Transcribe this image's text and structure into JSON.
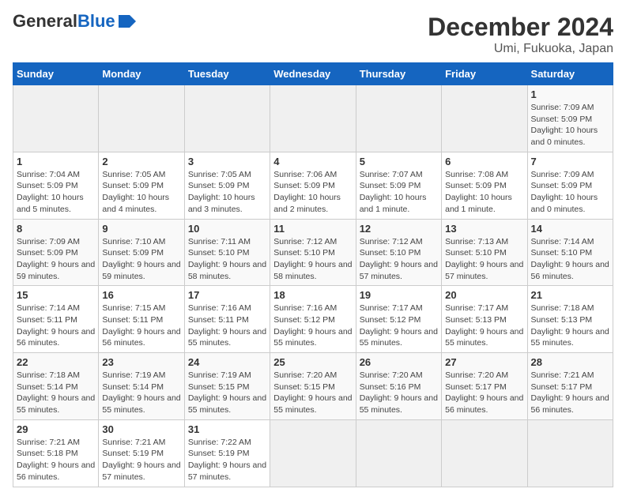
{
  "header": {
    "logo_general": "General",
    "logo_blue": "Blue",
    "title": "December 2024",
    "subtitle": "Umi, Fukuoka, Japan"
  },
  "calendar": {
    "columns": [
      "Sunday",
      "Monday",
      "Tuesday",
      "Wednesday",
      "Thursday",
      "Friday",
      "Saturday"
    ],
    "weeks": [
      [
        {
          "day": "",
          "empty": true
        },
        {
          "day": "",
          "empty": true
        },
        {
          "day": "",
          "empty": true
        },
        {
          "day": "",
          "empty": true
        },
        {
          "day": "",
          "empty": true
        },
        {
          "day": "",
          "empty": true
        },
        {
          "day": "1",
          "sunrise": "7:09 AM",
          "sunset": "5:09 PM",
          "daylight": "10 hours and 0 minutes."
        }
      ],
      [
        {
          "day": "1",
          "sunrise": "7:04 AM",
          "sunset": "5:09 PM",
          "daylight": "10 hours and 5 minutes."
        },
        {
          "day": "2",
          "sunrise": "7:05 AM",
          "sunset": "5:09 PM",
          "daylight": "10 hours and 4 minutes."
        },
        {
          "day": "3",
          "sunrise": "7:05 AM",
          "sunset": "5:09 PM",
          "daylight": "10 hours and 3 minutes."
        },
        {
          "day": "4",
          "sunrise": "7:06 AM",
          "sunset": "5:09 PM",
          "daylight": "10 hours and 2 minutes."
        },
        {
          "day": "5",
          "sunrise": "7:07 AM",
          "sunset": "5:09 PM",
          "daylight": "10 hours and 1 minute."
        },
        {
          "day": "6",
          "sunrise": "7:08 AM",
          "sunset": "5:09 PM",
          "daylight": "10 hours and 1 minute."
        },
        {
          "day": "7",
          "sunrise": "7:09 AM",
          "sunset": "5:09 PM",
          "daylight": "10 hours and 0 minutes."
        }
      ],
      [
        {
          "day": "8",
          "sunrise": "7:09 AM",
          "sunset": "5:09 PM",
          "daylight": "9 hours and 59 minutes."
        },
        {
          "day": "9",
          "sunrise": "7:10 AM",
          "sunset": "5:09 PM",
          "daylight": "9 hours and 59 minutes."
        },
        {
          "day": "10",
          "sunrise": "7:11 AM",
          "sunset": "5:10 PM",
          "daylight": "9 hours and 58 minutes."
        },
        {
          "day": "11",
          "sunrise": "7:12 AM",
          "sunset": "5:10 PM",
          "daylight": "9 hours and 58 minutes."
        },
        {
          "day": "12",
          "sunrise": "7:12 AM",
          "sunset": "5:10 PM",
          "daylight": "9 hours and 57 minutes."
        },
        {
          "day": "13",
          "sunrise": "7:13 AM",
          "sunset": "5:10 PM",
          "daylight": "9 hours and 57 minutes."
        },
        {
          "day": "14",
          "sunrise": "7:14 AM",
          "sunset": "5:10 PM",
          "daylight": "9 hours and 56 minutes."
        }
      ],
      [
        {
          "day": "15",
          "sunrise": "7:14 AM",
          "sunset": "5:11 PM",
          "daylight": "9 hours and 56 minutes."
        },
        {
          "day": "16",
          "sunrise": "7:15 AM",
          "sunset": "5:11 PM",
          "daylight": "9 hours and 56 minutes."
        },
        {
          "day": "17",
          "sunrise": "7:16 AM",
          "sunset": "5:11 PM",
          "daylight": "9 hours and 55 minutes."
        },
        {
          "day": "18",
          "sunrise": "7:16 AM",
          "sunset": "5:12 PM",
          "daylight": "9 hours and 55 minutes."
        },
        {
          "day": "19",
          "sunrise": "7:17 AM",
          "sunset": "5:12 PM",
          "daylight": "9 hours and 55 minutes."
        },
        {
          "day": "20",
          "sunrise": "7:17 AM",
          "sunset": "5:13 PM",
          "daylight": "9 hours and 55 minutes."
        },
        {
          "day": "21",
          "sunrise": "7:18 AM",
          "sunset": "5:13 PM",
          "daylight": "9 hours and 55 minutes."
        }
      ],
      [
        {
          "day": "22",
          "sunrise": "7:18 AM",
          "sunset": "5:14 PM",
          "daylight": "9 hours and 55 minutes."
        },
        {
          "day": "23",
          "sunrise": "7:19 AM",
          "sunset": "5:14 PM",
          "daylight": "9 hours and 55 minutes."
        },
        {
          "day": "24",
          "sunrise": "7:19 AM",
          "sunset": "5:15 PM",
          "daylight": "9 hours and 55 minutes."
        },
        {
          "day": "25",
          "sunrise": "7:20 AM",
          "sunset": "5:15 PM",
          "daylight": "9 hours and 55 minutes."
        },
        {
          "day": "26",
          "sunrise": "7:20 AM",
          "sunset": "5:16 PM",
          "daylight": "9 hours and 55 minutes."
        },
        {
          "day": "27",
          "sunrise": "7:20 AM",
          "sunset": "5:17 PM",
          "daylight": "9 hours and 56 minutes."
        },
        {
          "day": "28",
          "sunrise": "7:21 AM",
          "sunset": "5:17 PM",
          "daylight": "9 hours and 56 minutes."
        }
      ],
      [
        {
          "day": "29",
          "sunrise": "7:21 AM",
          "sunset": "5:18 PM",
          "daylight": "9 hours and 56 minutes."
        },
        {
          "day": "30",
          "sunrise": "7:21 AM",
          "sunset": "5:19 PM",
          "daylight": "9 hours and 57 minutes."
        },
        {
          "day": "31",
          "sunrise": "7:22 AM",
          "sunset": "5:19 PM",
          "daylight": "9 hours and 57 minutes."
        },
        {
          "day": "",
          "empty": true
        },
        {
          "day": "",
          "empty": true
        },
        {
          "day": "",
          "empty": true
        },
        {
          "day": "",
          "empty": true
        }
      ]
    ],
    "labels": {
      "sunrise": "Sunrise:",
      "sunset": "Sunset:",
      "daylight": "Daylight:"
    }
  }
}
